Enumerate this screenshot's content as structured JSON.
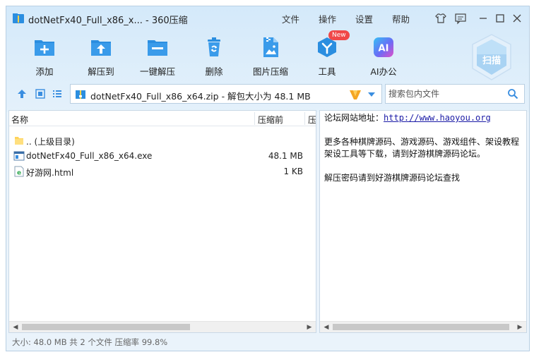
{
  "titlebar": {
    "title": "dotNetFx40_Full_x86_x... - 360压缩",
    "menus": [
      "文件",
      "操作",
      "设置",
      "帮助"
    ]
  },
  "toolbar": {
    "items": [
      {
        "label": "添加",
        "icon": "add-icon"
      },
      {
        "label": "解压到",
        "icon": "extract-to-icon"
      },
      {
        "label": "一键解压",
        "icon": "one-click-extract-icon"
      },
      {
        "label": "删除",
        "icon": "delete-icon"
      },
      {
        "label": "图片压缩",
        "icon": "image-compress-icon"
      },
      {
        "label": "工具",
        "icon": "tools-icon",
        "badge": "New"
      },
      {
        "label": "AI办公",
        "icon": "ai-office-icon",
        "icon_text": "AI"
      }
    ],
    "scan_label": "扫描"
  },
  "address": {
    "path": "dotNetFx40_Full_x86_x64.zip - 解包大小为 48.1 MB",
    "search_placeholder": "搜索包内文件"
  },
  "file_list": {
    "columns": [
      "名称",
      "压缩前",
      "压"
    ],
    "rows": [
      {
        "name": ".. (上级目录)",
        "size": "",
        "icon": "folder-icon"
      },
      {
        "name": "dotNetFx40_Full_x86_x64.exe",
        "size": "48.1 MB",
        "icon": "exe-icon"
      },
      {
        "name": "好游网.html",
        "size": "1 KB",
        "icon": "html-icon"
      }
    ]
  },
  "comment": {
    "line1_prefix": "论坛网站地址：",
    "line1_link": "http://www.haoyou.org",
    "line2": "更多各种棋牌源码、游戏源码、游戏组件、架设教程",
    "line3": "架设工具等下载，请到好游棋牌源码论坛。",
    "line4": "解压密码请到好游棋牌源码论坛查找"
  },
  "status": {
    "text": "大小: 48.0 MB 共 2 个文件 压缩率 99.8%"
  },
  "colors": {
    "accent": "#2b8ee0",
    "link": "#1a1aa6"
  }
}
